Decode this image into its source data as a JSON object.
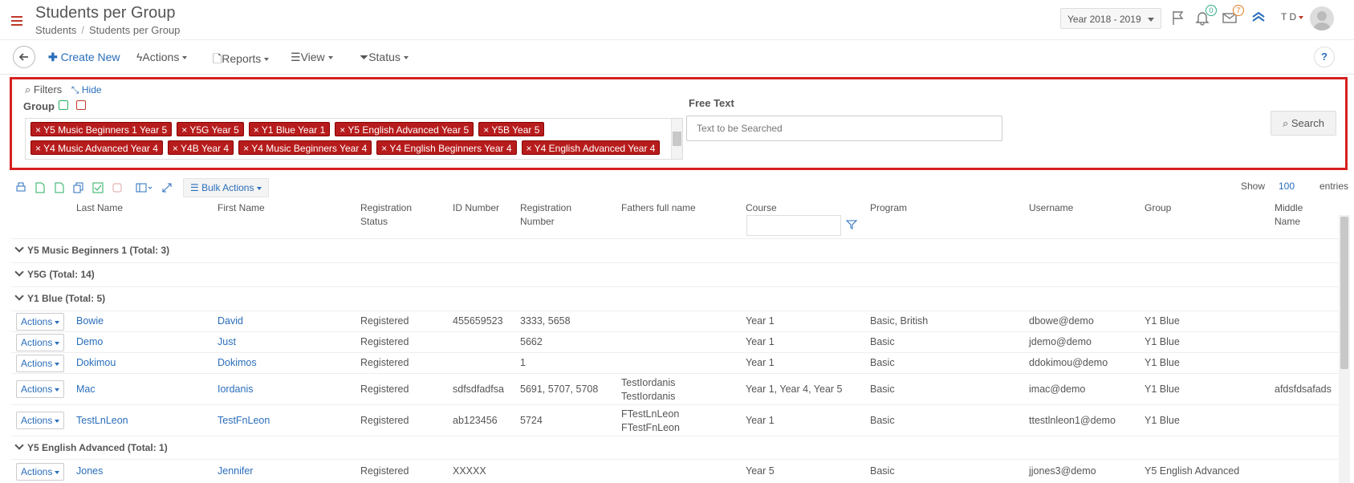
{
  "header": {
    "title": "Students per Group",
    "breadcrumb": [
      "Students",
      "Students per Group"
    ],
    "breadcrumb_sep": "/",
    "year": "Year 2018 - 2019",
    "notifications_count": "0",
    "messages_count": "7",
    "user_initials": "T D"
  },
  "toolbar": {
    "create_new": "Create New",
    "actions": "Actions",
    "reports": "Reports",
    "view": "View",
    "status": "Status",
    "help": "?"
  },
  "filters": {
    "title": "Filters",
    "hide": "Hide",
    "group_label": "Group",
    "chips_row1": [
      "Y5 Music Beginners 1 Year 5",
      "Y5G Year 5",
      "Y1 Blue Year 1",
      "Y5 English Advanced Year 5",
      "Y5B Year 5"
    ],
    "chips_row2": [
      "Y4 Music Advanced Year 4",
      "Y4B Year 4",
      "Y4 Music Beginners Year 4",
      "Y4 English Beginners Year 4",
      "Y4 English Advanced Year 4"
    ],
    "free_text_label": "Free Text",
    "free_text_placeholder": "Text to be Searched",
    "search": "Search"
  },
  "grid": {
    "bulk_actions": "Bulk Actions",
    "show": "Show",
    "show_value": "100",
    "entries": "entries",
    "columns": {
      "last_name": "Last Name",
      "first_name": "First Name",
      "reg_status_1": "Registration",
      "reg_status_2": "Status",
      "id_number": "ID Number",
      "reg_number_1": "Registration",
      "reg_number_2": "Number",
      "fathers": "Fathers full name",
      "course": "Course",
      "program": "Program",
      "username": "Username",
      "group": "Group",
      "middle_1": "Middle",
      "middle_2": "Name"
    },
    "action_label": "Actions",
    "groups": [
      {
        "label": "Y5 Music Beginners 1 (Total: 3)"
      },
      {
        "label": "Y5G (Total: 14)"
      },
      {
        "label": "Y1 Blue (Total: 5)"
      },
      {
        "label": "Y5 English Advanced (Total: 1)"
      }
    ],
    "rows": [
      {
        "last": "Bowie",
        "first": "David",
        "status": "Registered",
        "id": "455659523",
        "regno": "3333, 5658",
        "father1": "",
        "father2": "",
        "course": "Year 1",
        "program": "Basic, British",
        "username": "dbowe@demo",
        "group": "Y1 Blue",
        "middle": ""
      },
      {
        "last": "Demo",
        "first": "Just",
        "status": "Registered",
        "id": "",
        "regno": "5662",
        "father1": "",
        "father2": "",
        "course": "Year 1",
        "program": "Basic",
        "username": "jdemo@demo",
        "group": "Y1 Blue",
        "middle": ""
      },
      {
        "last": "Dokimou",
        "first": "Dokimos",
        "status": "Registered",
        "id": "",
        "regno": "1",
        "father1": "",
        "father2": "",
        "course": "Year 1",
        "program": "Basic",
        "username": "ddokimou@demo",
        "group": "Y1 Blue",
        "middle": ""
      },
      {
        "last": "Mac",
        "first": "Iordanis",
        "status": "Registered",
        "id": "sdfsdfadfsa",
        "regno": "5691, 5707, 5708",
        "father1": "TestIordanis",
        "father2": "TestIordanis",
        "course": "Year 1, Year 4, Year 5",
        "program": "Basic",
        "username": "imac@demo",
        "group": "Y1 Blue",
        "middle": "afdsfdsafads"
      },
      {
        "last": "TestLnLeon",
        "first": "TestFnLeon",
        "status": "Registered",
        "id": "ab123456",
        "regno": "5724",
        "father1": "FTestLnLeon",
        "father2": "FTestFnLeon",
        "course": "Year 1",
        "program": "Basic",
        "username": "ttestlnleon1@demo",
        "group": "Y1 Blue",
        "middle": ""
      },
      {
        "last": "Jones",
        "first": "Jennifer",
        "status": "Registered",
        "id": "XXXXX",
        "regno": "",
        "father1": "",
        "father2": "",
        "course": "Year 5",
        "program": "Basic",
        "username": "jjones3@demo",
        "group": "Y5 English Advanced",
        "middle": ""
      }
    ]
  },
  "colors": {
    "accent": "#2a6ebb",
    "chip": "#b71c1c",
    "highlight": "#d62020"
  }
}
